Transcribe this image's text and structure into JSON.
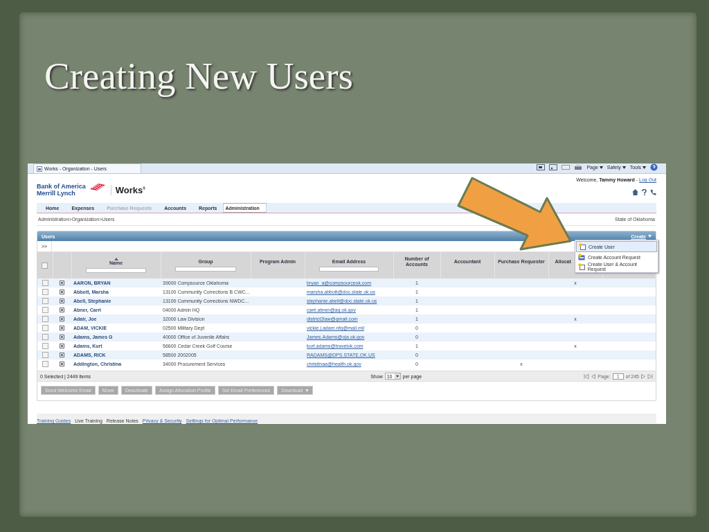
{
  "slide": {
    "title": "Creating New Users"
  },
  "browser": {
    "tab_title": "Works - Organization - Users",
    "menus": [
      "Page",
      "Safety",
      "Tools"
    ]
  },
  "header": {
    "brand_lines": [
      "Bank of America",
      "Merrill Lynch"
    ],
    "product": "Works",
    "trademark": "®",
    "welcome": "Welcome,",
    "user": "Tammy Howard",
    "separator": "-",
    "logout": "Log Out"
  },
  "nav": [
    {
      "label": "Home",
      "selected": false,
      "disabled": false
    },
    {
      "label": "Expenses",
      "selected": false,
      "disabled": false
    },
    {
      "label": "Purchase Requests",
      "selected": false,
      "disabled": true
    },
    {
      "label": "Accounts",
      "selected": false,
      "disabled": false
    },
    {
      "label": "Reports",
      "selected": false,
      "disabled": false
    },
    {
      "label": "Administration",
      "selected": true,
      "disabled": false
    }
  ],
  "breadcrumb": {
    "items": [
      "Administration",
      "Organization",
      "Users"
    ],
    "separator": ">",
    "organization": "State of Oklahoma"
  },
  "panel": {
    "title": "Users",
    "create": "Create",
    "expand": ">>"
  },
  "create_menu": [
    {
      "label": "Create User",
      "selected": true,
      "kind": "user"
    },
    {
      "label": "Create Account Request",
      "selected": false,
      "kind": "account"
    },
    {
      "label": "Create User & Account Request",
      "selected": false,
      "kind": "user"
    }
  ],
  "table": {
    "columns": [
      {
        "label": "Name",
        "filter": true,
        "sorted": true
      },
      {
        "label": "Group",
        "filter": true,
        "sorted": false
      },
      {
        "label": "Program Admin",
        "filter": false,
        "sorted": false
      },
      {
        "label": "Email Address",
        "filter": true,
        "sorted": false
      },
      {
        "label": "Number of Accounts",
        "filter": false,
        "sorted": false
      },
      {
        "label": "Accountant",
        "filter": false,
        "sorted": false
      },
      {
        "label": "Purchase Requester",
        "filter": false,
        "sorted": false
      },
      {
        "label": "Allocat",
        "filter": false,
        "sorted": false
      }
    ],
    "select_all_checked": false,
    "rows": [
      {
        "checked": false,
        "name": "AARON, BRYAN",
        "group": "39000 Compsource Oklahoma",
        "email": "bryan_a@compsourceok.com",
        "accounts": "1",
        "allocation": "x"
      },
      {
        "checked": false,
        "name": "Abbott, Marsha",
        "group": "13100 Community Corrections B CWC...",
        "email": "marsha.abbott@doc.state.ok.us",
        "accounts": "1"
      },
      {
        "checked": false,
        "name": "Abell, Stephanie",
        "group": "13100 Community Corrections NWDC...",
        "email": "stephanie.abell@doc.state.ok.us",
        "accounts": "1"
      },
      {
        "checked": false,
        "name": "Abner, Carri",
        "group": "04000 Admin HQ",
        "email": "carri.abner@ag.ok.gov",
        "accounts": "1"
      },
      {
        "checked": false,
        "name": "Adair, Joe",
        "group": "32000 Law Division",
        "email": "district2law@gmail.com",
        "accounts": "1",
        "allocation": "x"
      },
      {
        "checked": false,
        "name": "ADAM, VICKIE",
        "group": "02500 Military Dept",
        "email": "vickie.j.adam.nfg@mail.mil",
        "accounts": "0"
      },
      {
        "checked": false,
        "name": "Adams, James G",
        "group": "40000 Office of Juvenile Affairs",
        "email": "James.Adams@oja.ok.gov",
        "accounts": "0"
      },
      {
        "checked": false,
        "name": "Adams, Kurt",
        "group": "56600 Cedar Creek Golf Course",
        "email": "kurt.adams@travelok.com",
        "accounts": "1",
        "allocation": "x"
      },
      {
        "checked": false,
        "name": "ADAMS, RICK",
        "group": "58500 2002005",
        "email": "RADAMS@DPS.STATE.OK.US",
        "accounts": "0"
      },
      {
        "checked": false,
        "name": "Addington, Christina",
        "group": "34000 Procurement Services",
        "email": "christinaa@health.ok.gov",
        "accounts": "0",
        "purchase_requester": "x"
      }
    ]
  },
  "status": {
    "summary": "0 Selected | 2449 items",
    "show": "Show",
    "per_page_value": "10",
    "per_page": "per page",
    "page_label": "Page:",
    "page": "1",
    "page_total": "of 245"
  },
  "actions": [
    {
      "label": "Send Welcome Email",
      "disabled": true,
      "dropdown": false
    },
    {
      "label": "Move",
      "disabled": true,
      "dropdown": false
    },
    {
      "label": "Deactivate",
      "disabled": true,
      "dropdown": false
    },
    {
      "label": "Assign Allocation Profile",
      "disabled": true,
      "dropdown": false
    },
    {
      "label": "Set Email Preferences",
      "disabled": true,
      "dropdown": false
    },
    {
      "label": "Download",
      "disabled": true,
      "dropdown": true
    }
  ],
  "footer_links": [
    {
      "label": "Training Guides",
      "link": true
    },
    {
      "label": "Live Training",
      "link": false
    },
    {
      "label": "Release Notes",
      "link": false
    },
    {
      "label": "Privacy & Security",
      "link": true
    },
    {
      "label": "Settings for Optimal Performance",
      "link": true
    }
  ]
}
